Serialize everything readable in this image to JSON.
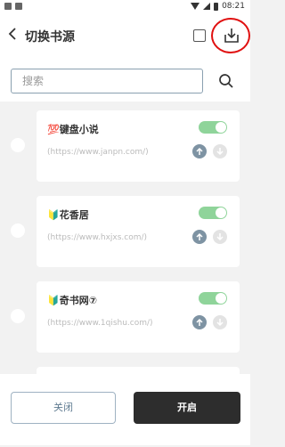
{
  "status_bar": {
    "time": "08:21"
  },
  "header": {
    "title": "切换书源",
    "back_icon": "chevron-left-icon",
    "import_icon": "download-tray-icon"
  },
  "search": {
    "placeholder": "搜索",
    "icon": "search-icon"
  },
  "sources": [
    {
      "name": "💯键盘小说",
      "url": "(https://www.janpn.com/)",
      "enabled": true
    },
    {
      "name": "🔰花香居",
      "url": "(https://www.hxjxs.com/)",
      "enabled": true
    },
    {
      "name": "🔰奇书网⑦",
      "url": "(https://www.1qishu.com/)",
      "enabled": true
    }
  ],
  "footer": {
    "close_label": "关闭",
    "open_label": "开启"
  },
  "colors": {
    "toggle_on": "#8fd49a",
    "highlight_circle": "#e01010",
    "primary_dark": "#2d2d2d"
  }
}
